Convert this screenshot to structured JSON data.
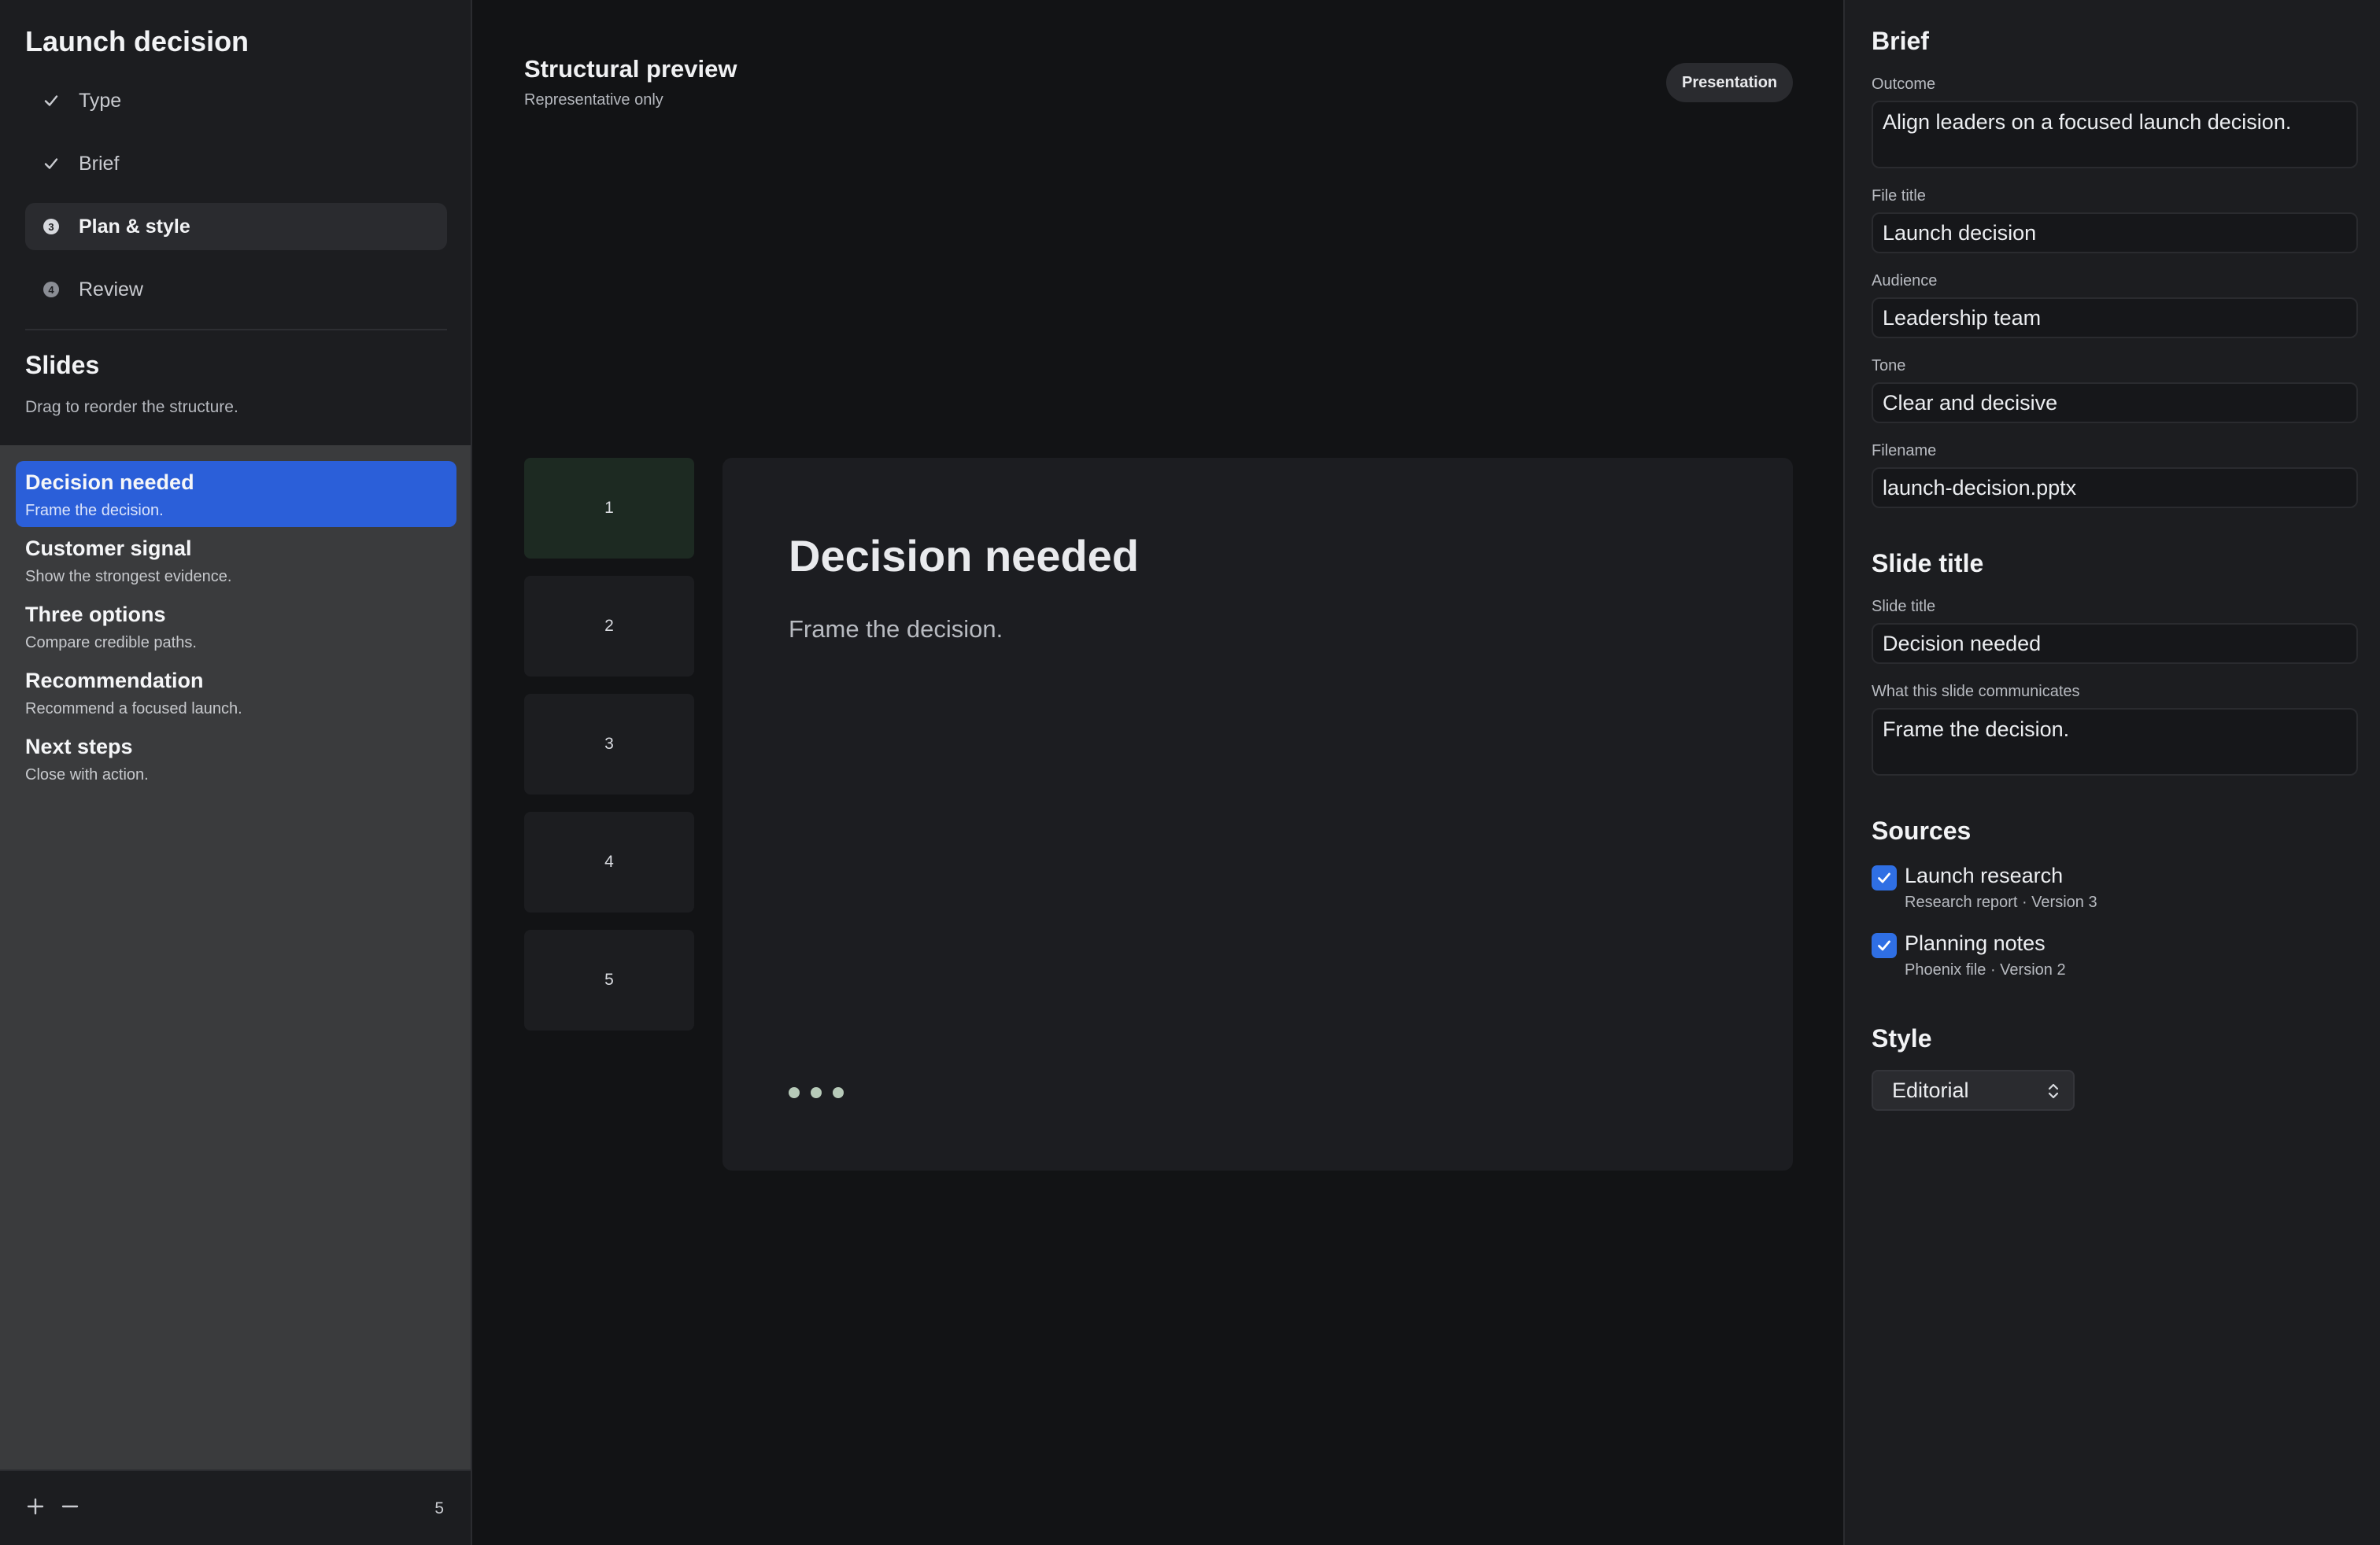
{
  "sidebar": {
    "title": "Launch decision",
    "steps": [
      {
        "label": "Type",
        "state": "done"
      },
      {
        "label": "Brief",
        "state": "done"
      },
      {
        "label": "Plan & style",
        "state": "active",
        "number": "3"
      },
      {
        "label": "Review",
        "state": "pending",
        "number": "4"
      }
    ],
    "slides_heading": "Slides",
    "slides_hint": "Drag to reorder the structure.",
    "slides": [
      {
        "title": "Decision needed",
        "subtitle": "Frame the decision.",
        "selected": true
      },
      {
        "title": "Customer signal",
        "subtitle": "Show the strongest evidence."
      },
      {
        "title": "Three options",
        "subtitle": "Compare credible paths."
      },
      {
        "title": "Recommendation",
        "subtitle": "Recommend a focused launch."
      },
      {
        "title": "Next steps",
        "subtitle": "Close with action."
      }
    ],
    "slide_count": "5",
    "add_icon": "plus-icon",
    "remove_icon": "minus-icon"
  },
  "preview": {
    "title": "Structural preview",
    "subtitle": "Representative only",
    "mode_pill": "Presentation",
    "thumbnails": [
      "1",
      "2",
      "3",
      "4",
      "5"
    ],
    "selected_thumbnail": "1",
    "slide_title": "Decision needed",
    "slide_body": "Frame the decision."
  },
  "inspector": {
    "brief_heading": "Brief",
    "outcome_label": "Outcome",
    "outcome_value": "Align leaders on a focused launch decision.",
    "file_title_label": "File title",
    "file_title_value": "Launch decision",
    "audience_label": "Audience",
    "audience_value": "Leadership team",
    "tone_label": "Tone",
    "tone_value": "Clear and decisive",
    "filename_label": "Filename",
    "filename_value": "launch-decision.pptx",
    "slide_heading": "Slide title",
    "slide_title_label": "Slide title",
    "slide_title_value": "Decision needed",
    "communicates_label": "What this slide communicates",
    "communicates_value": "Frame the decision.",
    "sources_heading": "Sources",
    "sources": [
      {
        "name": "Launch research",
        "meta": "Research report · Version 3",
        "checked": true
      },
      {
        "name": "Planning notes",
        "meta": "Phoenix file · Version 2",
        "checked": true
      }
    ],
    "style_heading": "Style",
    "style_value": "Editorial"
  },
  "colors": {
    "accent": "#2b5fd9",
    "checkbox": "#2f6fe4",
    "background": "#141517"
  }
}
